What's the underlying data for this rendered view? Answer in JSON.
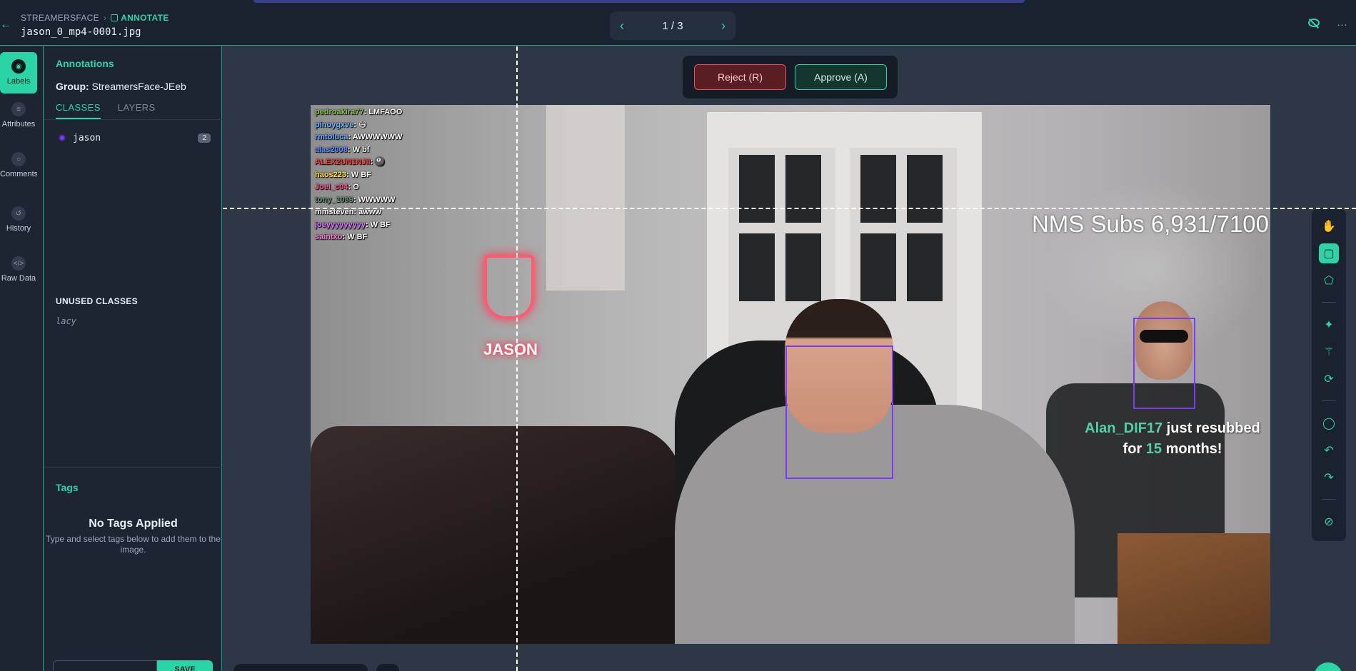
{
  "topbar": {
    "breadcrumb": {
      "project": "STREAMERSFACE",
      "mode": "ANNOTATE"
    },
    "filename": "jason_0_mp4-0001.jpg",
    "pager": {
      "text": "1 / 3",
      "prev": "‹",
      "next": "›"
    },
    "icons": [
      "back-arrow-icon",
      "eye-off-icon",
      "more-icon"
    ]
  },
  "rail": {
    "items": [
      {
        "label": "Labels",
        "icon": "tag-icon",
        "active": true
      },
      {
        "label": "Attributes",
        "icon": "list-icon"
      },
      {
        "label": "Comments",
        "icon": "comment-icon"
      },
      {
        "label": "History",
        "icon": "history-icon"
      },
      {
        "label": "Raw Data",
        "icon": "code-icon"
      }
    ]
  },
  "panel": {
    "title": "Annotations",
    "group_label": "Group:",
    "group_value": "StreamersFace-JEeb",
    "tabs": [
      "CLASSES",
      "LAYERS"
    ],
    "classes": [
      {
        "name": "jason",
        "count": "2",
        "color": "#7a3df5"
      }
    ],
    "unused_title": "UNUSED CLASSES",
    "unused": [
      "lacy"
    ],
    "tags_title": "Tags",
    "no_tags_title": "No Tags Applied",
    "no_tags_desc": "Type and select tags below to add them to the image.",
    "save_label": "SAVE"
  },
  "review": {
    "reject": "Reject (R)",
    "approve": "Approve (A)"
  },
  "overlay": {
    "subs": "NMS Subs 6,931/7100",
    "resub_user": "Alan_DIF17",
    "resub_mid": "just resubbed",
    "resub_for": "for",
    "resub_count": "15",
    "resub_end": "months!",
    "chat": [
      {
        "user": "pedroakira77",
        "msg": ": LMFAOO",
        "color": "#8bc34a"
      },
      {
        "user": "pinoygxve",
        "msg": ": 😄",
        "color": "#6fb5ff"
      },
      {
        "user": "rmtoluca",
        "msg": ": AWWWWWW",
        "color": "#62a8ff"
      },
      {
        "user": "alas2008",
        "msg": ": W bf",
        "color": "#5b8dff"
      },
      {
        "user": "ALEX2UN1NJII",
        "msg": ": 🎱",
        "color": "#ff3b3b"
      },
      {
        "user": "haos223",
        "msg": ": W BF",
        "color": "#ffe13b"
      },
      {
        "user": "Joel_c04",
        "msg": ": O",
        "color": "#ff4f8b"
      },
      {
        "user": "tony_1089",
        "msg": ": WWWWW",
        "color": "#6b8f7a"
      },
      {
        "user": "mmsteven",
        "msg": ": awww",
        "color": "#ffffff"
      },
      {
        "user": "joeyyyyyyyyy",
        "msg": ": W BF",
        "color": "#d874ff"
      },
      {
        "user": "saintxo",
        "msg": ": W BF",
        "color": "#ff78d4"
      }
    ]
  },
  "toolbar": {
    "tools": [
      "hand-icon",
      "bounding-box-icon",
      "polygon-icon",
      "smart-select-icon",
      "magic-wand-icon",
      "repeat-icon",
      "comment-icon",
      "undo-icon",
      "redo-icon",
      "null-icon"
    ]
  }
}
